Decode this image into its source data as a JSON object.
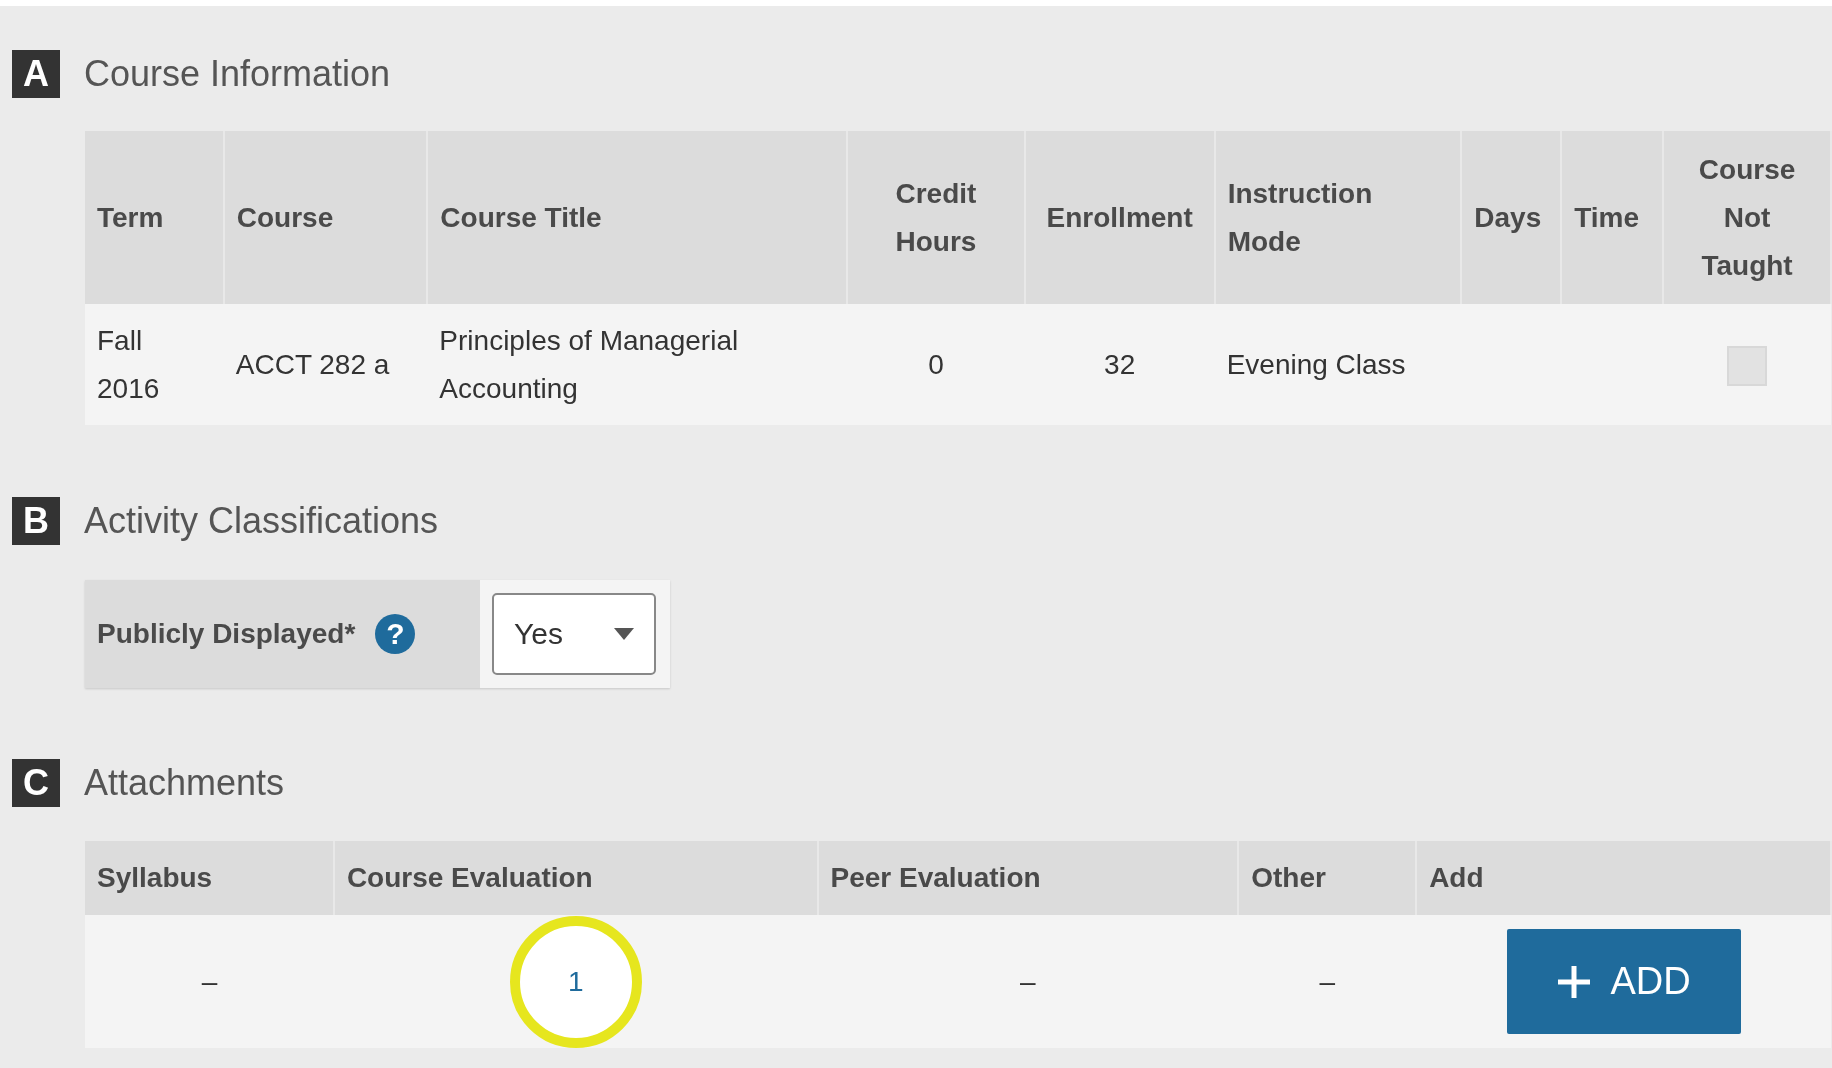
{
  "course_information": {
    "letter": "A",
    "title": "Course Information",
    "columns": [
      "Term",
      "Course",
      "Course Title",
      "Credit Hours",
      "Enrollment",
      "Instruction Mode",
      "Days",
      "Time",
      "Course Not Taught"
    ],
    "rows": [
      {
        "cells": [
          {
            "kind": "text",
            "text": "Fall 2016"
          },
          {
            "kind": "text",
            "text": "ACCT 282 a"
          },
          {
            "kind": "text",
            "text": "Principles of Managerial Accounting"
          },
          {
            "kind": "text",
            "text": "0"
          },
          {
            "kind": "text",
            "text": "32"
          },
          {
            "kind": "text",
            "text": "Evening Class"
          },
          {
            "kind": "blank"
          },
          {
            "kind": "blank"
          },
          {
            "kind": "checkbox",
            "checked": false,
            "disabled": true
          }
        ]
      }
    ]
  },
  "activity_classifications": {
    "letter": "B",
    "title": "Activity Classifications",
    "field": {
      "label": "Publicly Displayed*",
      "help": "?",
      "value": "Yes"
    }
  },
  "attachments": {
    "letter": "C",
    "title": "Attachments",
    "columns": [
      "Syllabus",
      "Course Evaluation",
      "Peer Evaluation",
      "Other",
      "Add"
    ],
    "rows": [
      {
        "cells": [
          {
            "kind": "text",
            "text": "–",
            "highlighted": false
          },
          {
            "kind": "link",
            "text": "1",
            "highlighted": true
          },
          {
            "kind": "text",
            "text": "–",
            "highlighted": false
          },
          {
            "kind": "text",
            "text": "–",
            "highlighted": false
          },
          {
            "kind": "button",
            "text": "ADD",
            "highlighted": false
          }
        ]
      }
    ]
  }
}
